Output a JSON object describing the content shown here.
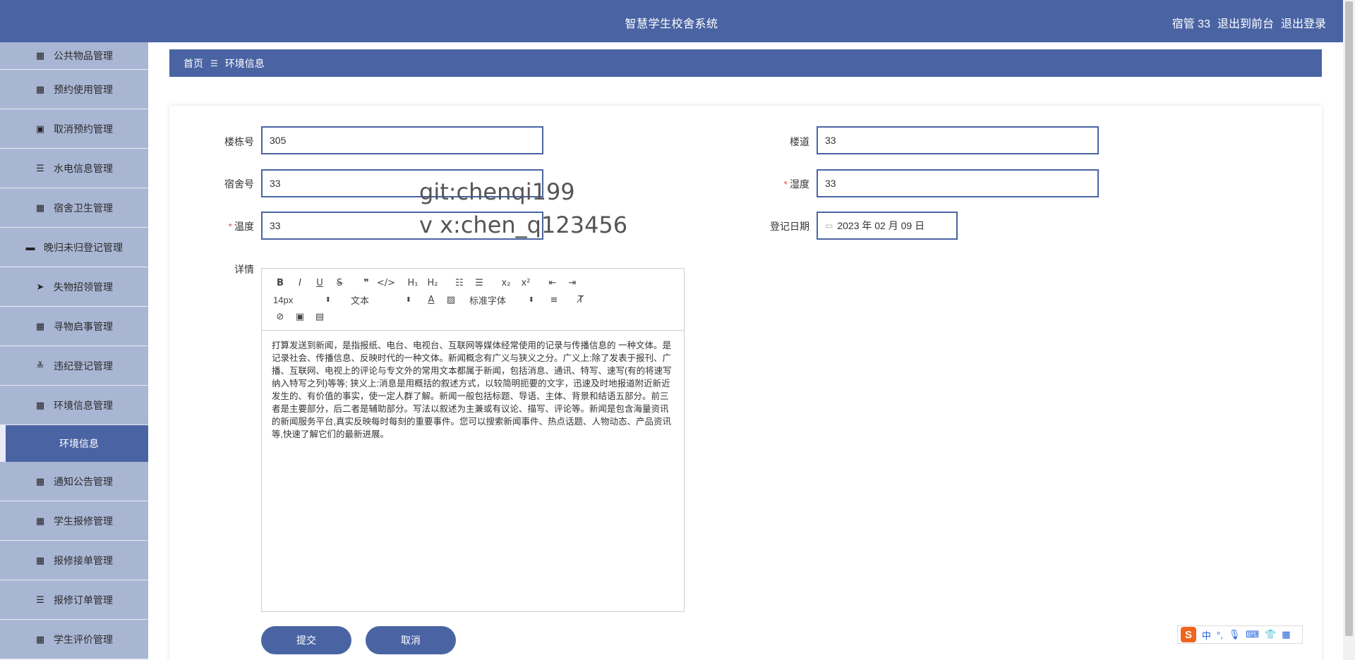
{
  "header": {
    "title": "智慧学生校舍系统",
    "user": "宿管 33",
    "to_front": "退出到前台",
    "logout": "退出登录"
  },
  "sidebar": {
    "items": [
      {
        "label": "公共物品管理",
        "icon": "grid-icon"
      },
      {
        "label": "预约使用管理",
        "icon": "grid-icon"
      },
      {
        "label": "取消预约管理",
        "icon": "clipboard-icon"
      },
      {
        "label": "水电信息管理",
        "icon": "list-icon"
      },
      {
        "label": "宿舍卫生管理",
        "icon": "grid-icon"
      },
      {
        "label": "晚归未归登记管理",
        "icon": "briefcase-icon"
      },
      {
        "label": "失物招领管理",
        "icon": "paper-plane-icon"
      },
      {
        "label": "寻物启事管理",
        "icon": "grid-icon"
      },
      {
        "label": "违纪登记管理",
        "icon": "sliders-icon"
      },
      {
        "label": "环境信息管理",
        "icon": "grid-icon"
      }
    ],
    "active_sub": "环境信息",
    "items_after": [
      {
        "label": "通知公告管理",
        "icon": "grid-icon"
      },
      {
        "label": "学生报修管理",
        "icon": "grid-icon"
      },
      {
        "label": "报修接单管理",
        "icon": "grid-icon"
      },
      {
        "label": "报修订单管理",
        "icon": "list-icon"
      },
      {
        "label": "学生评价管理",
        "icon": "grid-icon"
      }
    ]
  },
  "breadcrumb": {
    "home": "首页",
    "separator": "☰",
    "current": "环境信息"
  },
  "form": {
    "building_label": "楼栋号",
    "building_value": "305",
    "corridor_label": "楼道",
    "corridor_value": "33",
    "room_label": "宿舍号",
    "room_value": "33",
    "humidity_label": "湿度",
    "humidity_value": "33",
    "temperature_label": "温度",
    "temperature_value": "33",
    "date_label": "登记日期",
    "date_value": "2023 年 02 月 09 日",
    "details_label": "详情"
  },
  "editor": {
    "font_size": "14px",
    "heading": "文本",
    "font_family": "标准字体",
    "content": "打算发送到新闻，是指报纸、电台、电视台、互联网等媒体经常使用的记录与传播信息的 一种文体。是记录社会、传播信息、反映时代的一种文体。新闻概念有广义与狭义之分。广义上:除了发表于报刊、广播、互联网、电视上的评论与专文外的常用文本都属于新闻，包括消息、通讯、特写、速写(有的将速写纳入特写之列)等等; 狭义上:消息是用概括的叙述方式，以较简明扼要的文字，迅速及时地报道附近新近发生的、有价值的事实，使一定人群了解。新闻一般包括标题、导语、主体、背景和结语五部分。前三者是主要部分，后二者是辅助部分。写法以叙述为主兼或有议论、描写、评论等。新闻是包含海量资讯的新闻服务平台,真实反映每时每刻的重要事件。您可以搜索新闻事件、热点话题、人物动态、产品资讯等,快速了解它们的最新进展。"
  },
  "buttons": {
    "submit": "提交",
    "cancel": "取消"
  },
  "watermark": {
    "line1": "git:chenqi199",
    "line2": "v x:chen_q123456"
  },
  "ime": {
    "lang": "中",
    "punct": "°,",
    "logo": "S"
  },
  "colors": {
    "primary": "#4a64a3",
    "sidebar_item": "#a9b6d3",
    "required": "#e45c5c"
  }
}
